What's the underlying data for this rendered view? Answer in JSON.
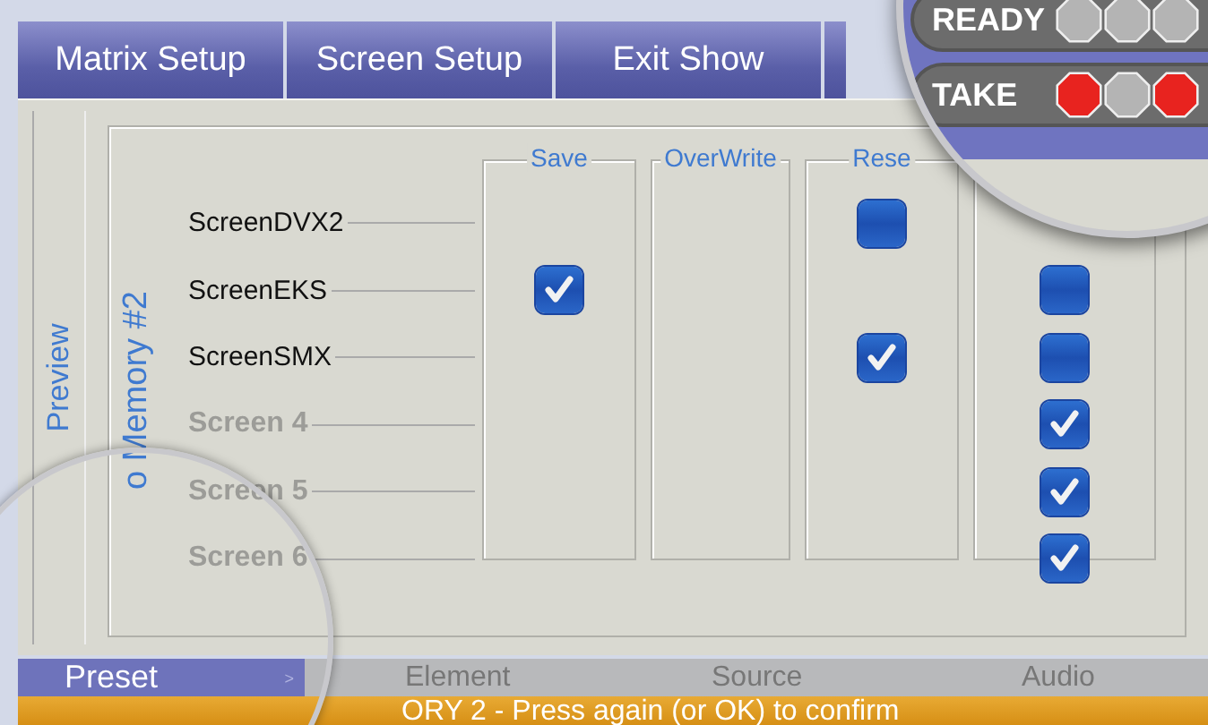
{
  "tabs": [
    {
      "label": "Matrix Setup"
    },
    {
      "label": "Screen Setup"
    },
    {
      "label": "Exit Show"
    }
  ],
  "preview_label": "Preview",
  "memory_group": {
    "label": "o Memory #2",
    "headings": [
      "Save",
      "OverWrite",
      "Rese"
    ],
    "rows": [
      {
        "label": "ScreenDVX2",
        "disabled": false,
        "cells": [
          {
            "kind": "empty"
          },
          {
            "kind": "empty"
          },
          {
            "kind": "checkbox",
            "checked": false
          },
          {
            "kind": "empty"
          }
        ]
      },
      {
        "label": "ScreenEKS",
        "disabled": false,
        "cells": [
          {
            "kind": "checkbox",
            "checked": true
          },
          {
            "kind": "empty"
          },
          {
            "kind": "empty"
          },
          {
            "kind": "checkbox",
            "checked": false
          }
        ]
      },
      {
        "label": "ScreenSMX",
        "disabled": false,
        "cells": [
          {
            "kind": "empty"
          },
          {
            "kind": "empty"
          },
          {
            "kind": "checkbox",
            "checked": true
          },
          {
            "kind": "checkbox",
            "checked": false
          }
        ]
      },
      {
        "label": "Screen 4",
        "disabled": true,
        "cells": [
          {
            "kind": "empty"
          },
          {
            "kind": "empty"
          },
          {
            "kind": "empty"
          },
          {
            "kind": "checkbox",
            "checked": true
          }
        ]
      },
      {
        "label": "Screen 5",
        "disabled": true,
        "cells": [
          {
            "kind": "empty"
          },
          {
            "kind": "empty"
          },
          {
            "kind": "empty"
          },
          {
            "kind": "checkbox",
            "checked": true
          }
        ]
      },
      {
        "label": "Screen 6",
        "disabled": true,
        "cells": [
          {
            "kind": "empty"
          },
          {
            "kind": "empty"
          },
          {
            "kind": "empty"
          },
          {
            "kind": "checkbox",
            "checked": true
          }
        ]
      }
    ]
  },
  "indicators": [
    {
      "label": "READY",
      "lights": [
        {
          "color": "#b4b4b4"
        },
        {
          "color": "#b4b4b4"
        },
        {
          "color": "#b4b4b4"
        }
      ]
    },
    {
      "label": "TAKE",
      "lights": [
        {
          "color": "#e8231f"
        },
        {
          "color": "#b4b4b4"
        },
        {
          "color": "#e8231f"
        }
      ]
    }
  ],
  "bottom_bar": {
    "preset": "Preset",
    "arrow": ">",
    "columns": [
      "Element",
      "Source",
      "Audio"
    ]
  },
  "status": "ORY 2 - Press again (or OK) to confirm"
}
